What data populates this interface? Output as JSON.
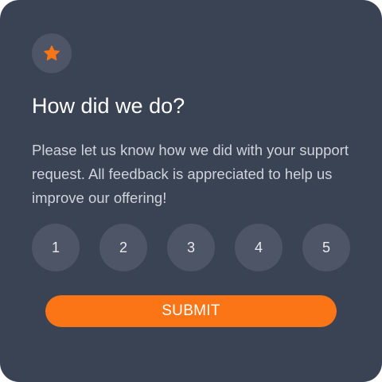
{
  "card": {
    "icon": "star-icon",
    "title": "How did we do?",
    "description": "Please let us know how we did with your support request. All feedback is appreciated to help us improve our offering!",
    "ratings": [
      "1",
      "2",
      "3",
      "4",
      "5"
    ],
    "submit_label": "SUBMIT"
  },
  "colors": {
    "card_background": "#3a4354",
    "circle_background": "#4d5566",
    "accent": "#fb7415",
    "title_text": "#ffffff",
    "body_text": "#cfd3da"
  }
}
